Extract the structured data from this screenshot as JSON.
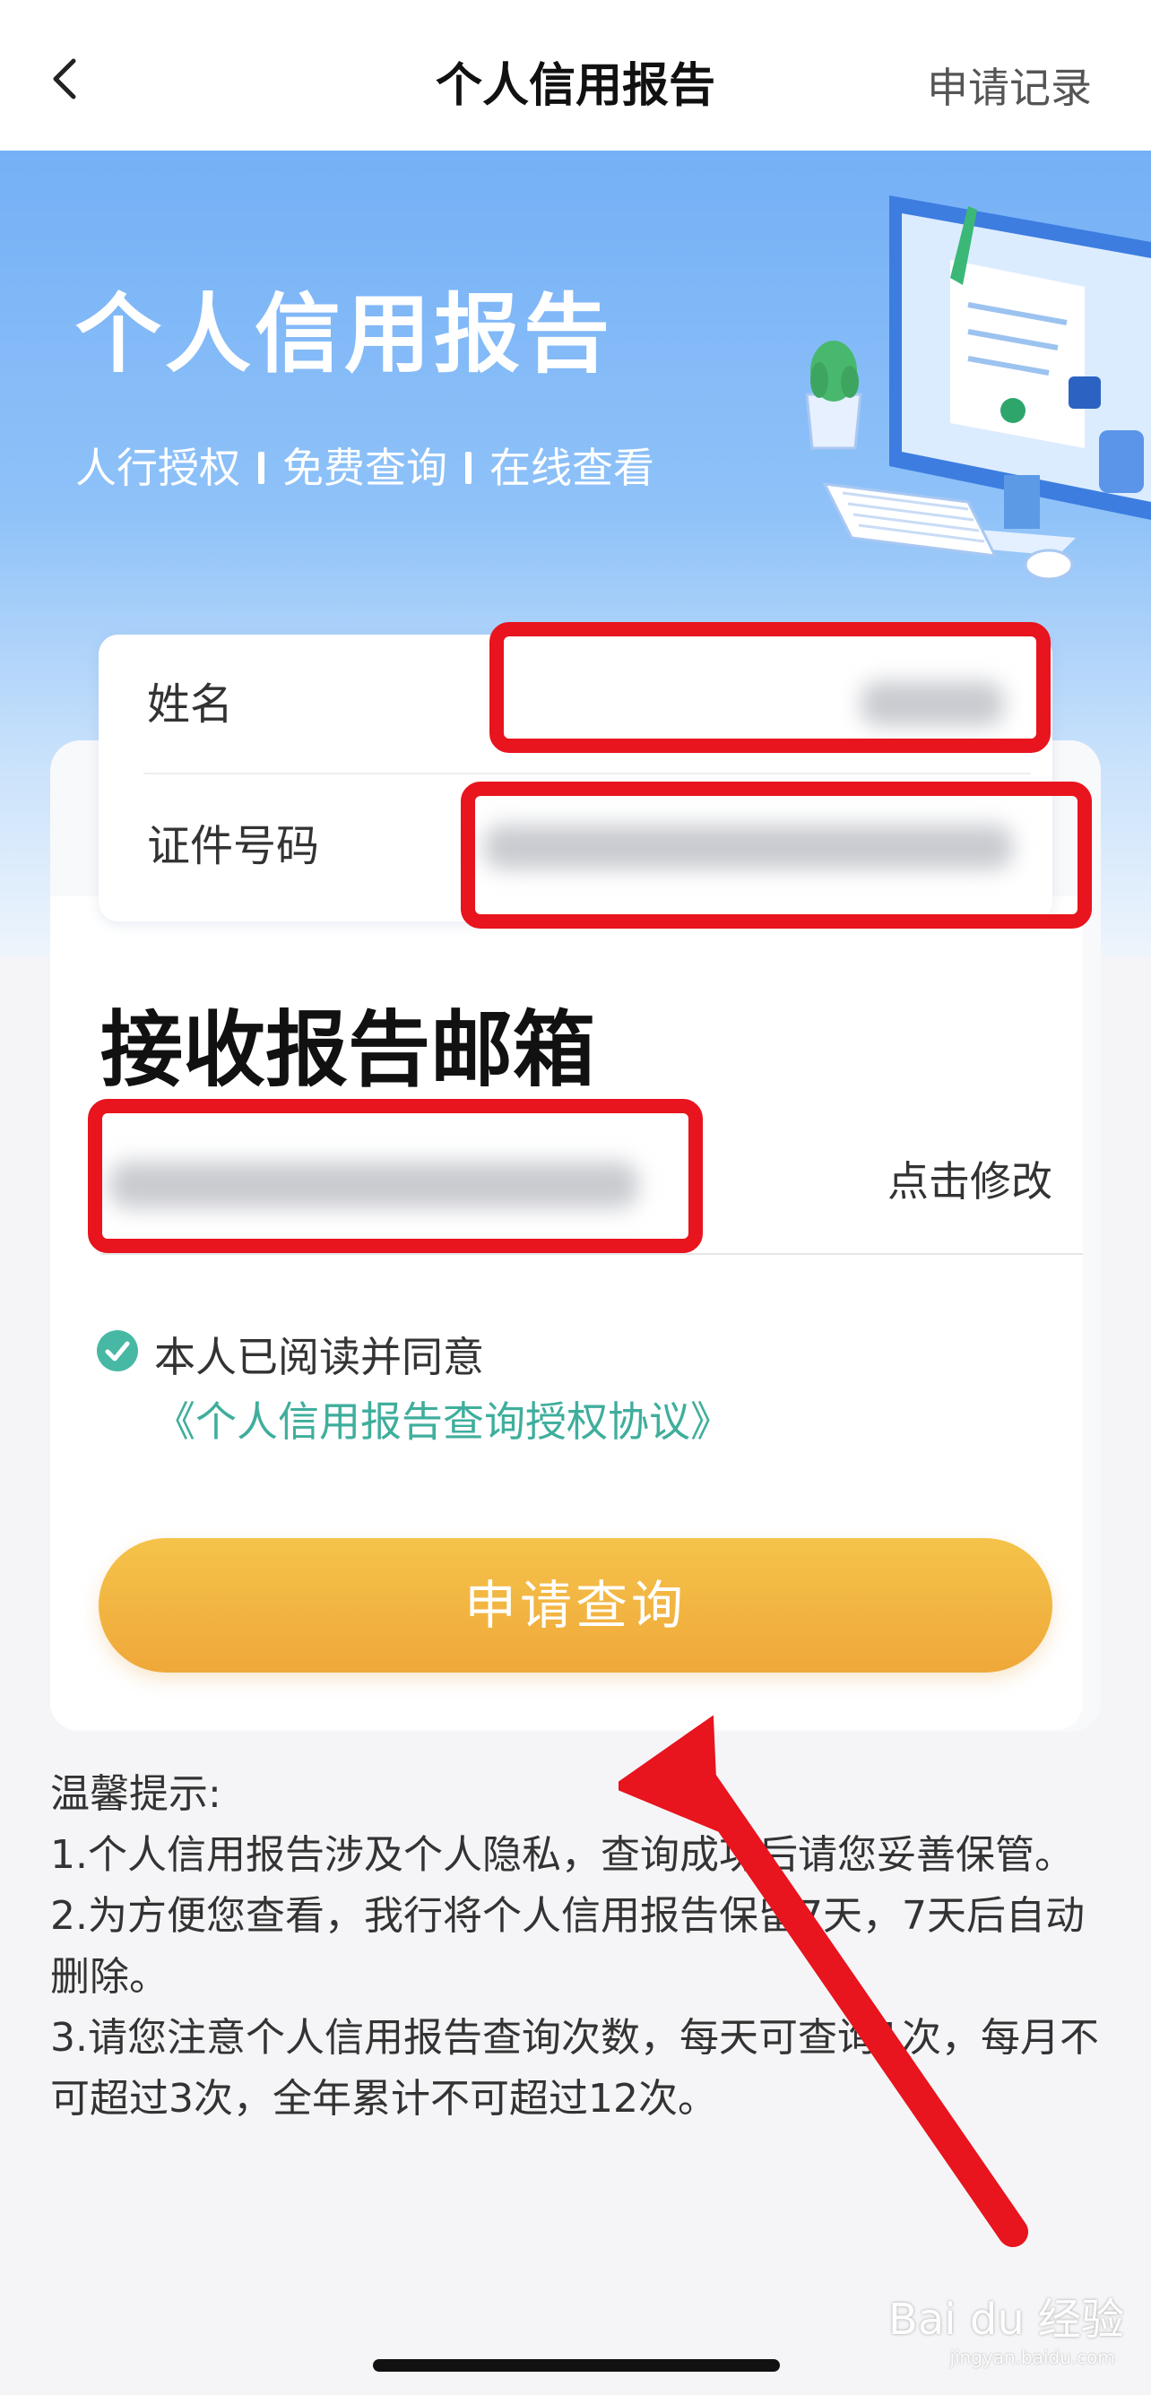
{
  "nav": {
    "title": "个人信用报告",
    "history_label": "申请记录"
  },
  "hero": {
    "title": "个人信用报告",
    "features": [
      "人行授权",
      "免费查询",
      "在线查看"
    ]
  },
  "form": {
    "name_label": "姓名",
    "id_label": "证件号码"
  },
  "email": {
    "title": "接收报告邮箱",
    "modify_label": "点击修改"
  },
  "agreement": {
    "checked": true,
    "text": "本人已阅读并同意 ",
    "link": "《个人信用报告查询授权协议》"
  },
  "submit_label": "申请查询",
  "tips": {
    "heading": "温馨提示:",
    "items": [
      "1.个人信用报告涉及个人隐私，查询成功后请您妥善保管。",
      "2.为方便您查看，我行将个人信用报告保留7天，7天后自动删除。",
      "3.请您注意个人信用报告查询次数，每天可查询1次，每月不可超过3次，全年累计不可超过12次。"
    ]
  },
  "watermark": {
    "brand": "Bai du 经验",
    "url": "jingyan.baidu.com"
  },
  "colors": {
    "accent": "#3fae9c",
    "button": "#f2b440",
    "annotation": "#e8141e",
    "hero_top": "#75b0f6"
  }
}
